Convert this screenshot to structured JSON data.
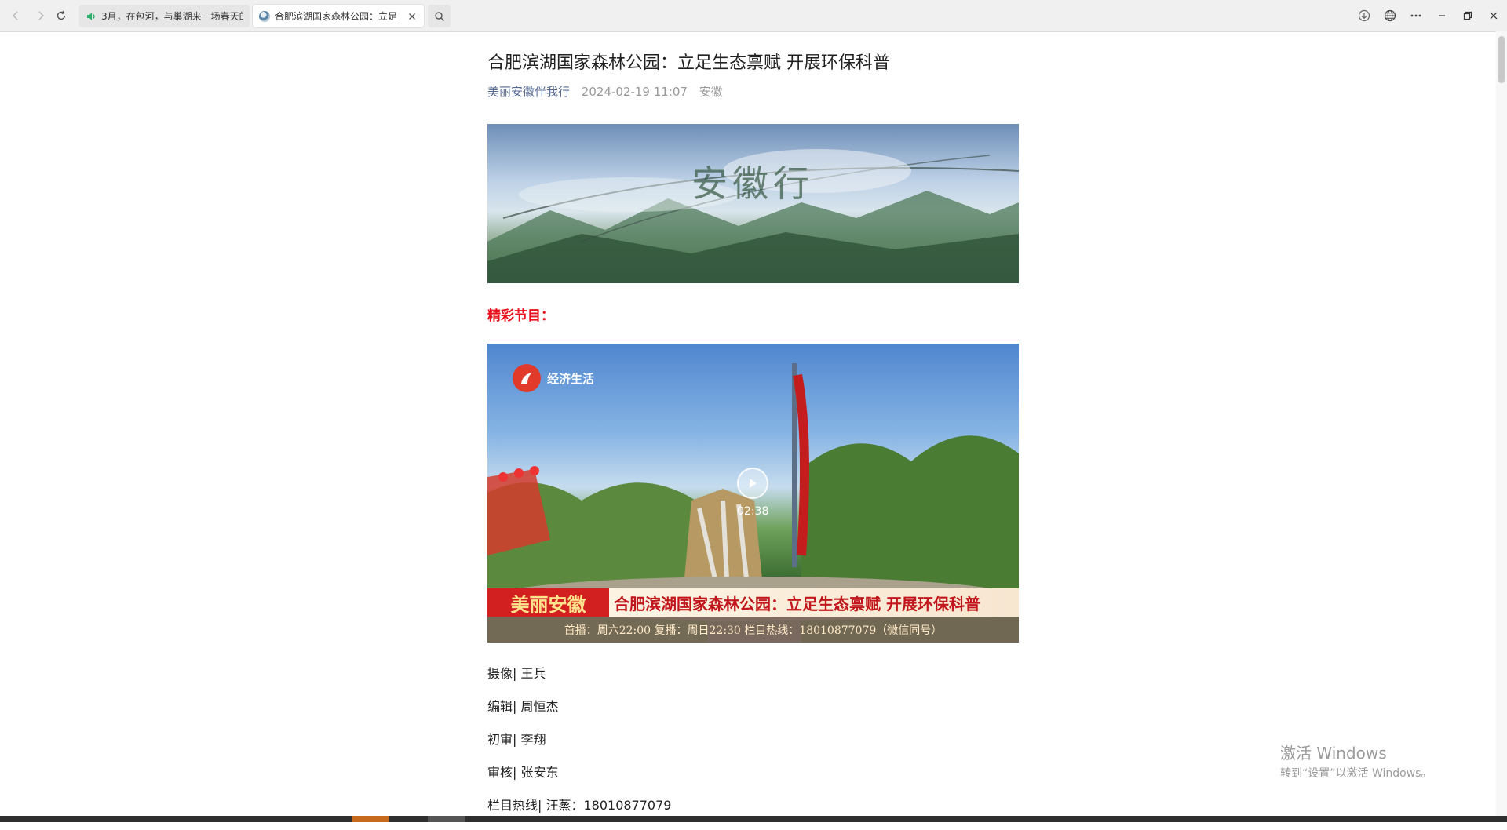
{
  "browser": {
    "tabs": [
      {
        "label": "3月，在包河，与巢湖来一场春天的",
        "state": "inactive",
        "audio": true
      },
      {
        "label": "合肥滨湖国家森林公园：立足",
        "state": "active",
        "audio": false
      }
    ],
    "icons": {
      "back": "back-arrow-icon",
      "forward": "forward-arrow-icon",
      "reload": "reload-icon",
      "search": "search-icon",
      "download": "download-icon",
      "translate": "globe-icon",
      "more": "more-dots-icon",
      "minimize": "minimize-icon",
      "restore": "restore-icon",
      "close": "close-icon"
    },
    "accent_audio": "#2aae67"
  },
  "article": {
    "title": "合肥滨湖国家森林公园：立足生态禀赋 开展环保科普",
    "author": "美丽安徽伴我行",
    "date": "2024-02-19 11:07",
    "region": "安徽",
    "banner_text": "安徽行",
    "section_heading": "精彩节目：",
    "video": {
      "channel_name": "经济生活",
      "duration": "02:38",
      "brand": "美丽安徽",
      "headline": "合肥滨湖国家森林公园：立足生态禀赋 开展环保科普",
      "schedule": "首播：周六22:00   复播：周日22:30   栏目热线：18010877079（微信同号）"
    },
    "credits": [
      "摄像| 王兵",
      "编辑| 周恒杰",
      "初审| 李翔",
      "审核| 张安东",
      "栏目热线| 汪蒸：18010877079"
    ],
    "colors": {
      "title": "#222222",
      "author": "#576b95",
      "meta": "#9a9a9a",
      "section_heading": "#e8101d"
    }
  },
  "watermark": {
    "title": "激活 Windows",
    "subtitle": "转到“设置”以激活 Windows。"
  }
}
